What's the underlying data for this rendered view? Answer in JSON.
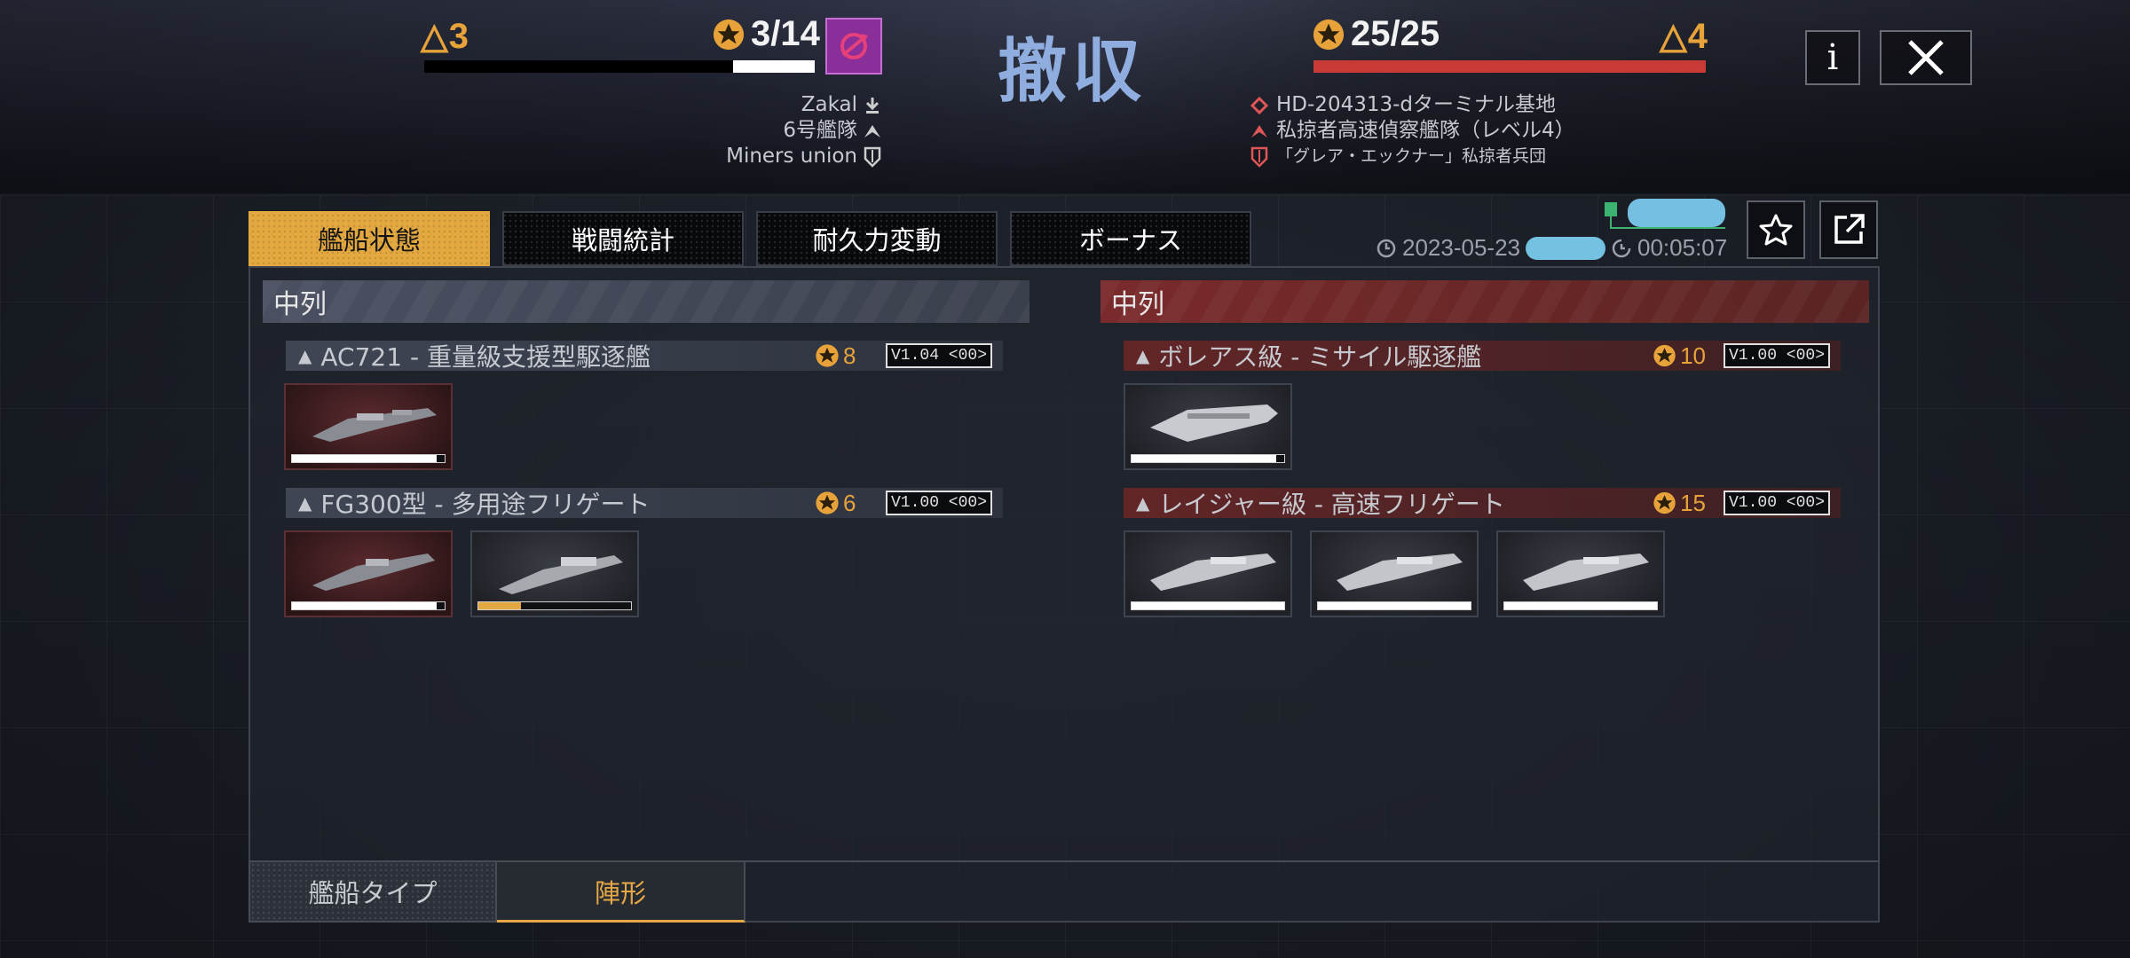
{
  "header": {
    "left_tier": "△3",
    "left_score": "3/14",
    "result_title": "撤収",
    "right_score": "25/25",
    "right_tier": "△4",
    "left_info": {
      "player": "Zakal",
      "fleet": "6号艦隊",
      "union": "Miners union"
    },
    "right_info": {
      "location": "HD-204313-dターミナル基地",
      "enemy_fleet": "私掠者高速偵察艦隊（レベル4）",
      "enemy_faction": "「グレア・エックナー」私掠者兵団"
    },
    "info_label": "i",
    "left_hp_fraction": 0.21,
    "right_hp_fraction": 1.0
  },
  "tabs": [
    {
      "label": "艦船状態",
      "active": true
    },
    {
      "label": "戦闘統計",
      "active": false
    },
    {
      "label": "耐久力変動",
      "active": false
    },
    {
      "label": "ボーナス",
      "active": false
    }
  ],
  "battle_meta": {
    "date": "2023-05-23",
    "duration": "00:05:07"
  },
  "left_column": {
    "title": "中列",
    "groups": [
      {
        "name": "AC721 - 重量級支援型駆逐艦",
        "count": "8",
        "version": "V1.04 <00>",
        "ships_hp": [
          0.95
        ]
      },
      {
        "name": "FG300型 - 多用途フリゲート",
        "count": "6",
        "version": "V1.00 <00>",
        "ships_hp": [
          0.95,
          0.28
        ]
      }
    ]
  },
  "right_column": {
    "title": "中列",
    "groups": [
      {
        "name": "ボレアス級 - ミサイル駆逐艦",
        "count": "10",
        "version": "V1.00 <00>",
        "ships_hp": [
          0.95
        ]
      },
      {
        "name": "レイジャー級 - 高速フリゲート",
        "count": "15",
        "version": "V1.00 <00>",
        "ships_hp": [
          1.0,
          1.0,
          1.0
        ]
      }
    ]
  },
  "bottom_tabs": [
    {
      "label": "艦船タイプ",
      "active": false
    },
    {
      "label": "陣形",
      "active": true
    }
  ],
  "colors": {
    "accent": "#e3a83f",
    "title_blue": "#8faedf",
    "enemy_red": "#c83a35"
  }
}
